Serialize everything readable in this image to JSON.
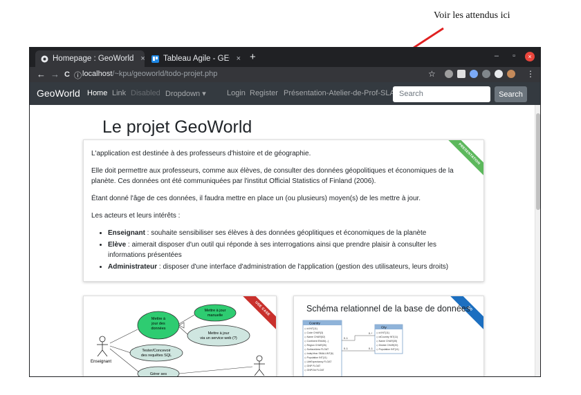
{
  "annotation": {
    "text": "Voir les attendus ici"
  },
  "browser": {
    "tabs": [
      {
        "label": "Homepage : GeoWorld",
        "close": "×"
      },
      {
        "label": "Tableau Agile - GEOWORL",
        "close": "×"
      }
    ],
    "new_tab": "+",
    "window_controls": {
      "minimize": "–",
      "maximize": "▫",
      "close": "×"
    },
    "nav": {
      "back": "←",
      "forward": "→",
      "reload": "C",
      "info": "ⓘ"
    },
    "url_host": "localhost",
    "url_path": "/~kpu/geoworld/todo-projet.php",
    "star": "☆",
    "menu": "⋮"
  },
  "navbar": {
    "brand": "GeoWorld",
    "links": [
      {
        "label": "Home",
        "state": "active"
      },
      {
        "label": "Link",
        "state": "normal"
      },
      {
        "label": "Disabled",
        "state": "disabled"
      },
      {
        "label": "Dropdown ▾",
        "state": "normal"
      }
    ],
    "right_links": [
      "Login",
      "Register",
      "Présentation-Atelier-de-Prof-SLAM"
    ],
    "search_placeholder": "Search",
    "search_button": "Search"
  },
  "page": {
    "title": "Le projet GeoWorld",
    "intro": {
      "ribbon": "PRESENTATION",
      "p1": "L'application est destinée à des professeurs d'histoire et de géographie.",
      "p2": "Elle doit permettre aux professeurs, comme aux élèves, de consulter des données géopolitiques et économiques de la planète. Ces données ont été communiquées par l'institut Official Statistics of Finland (2006).",
      "p3": "Étant donné l'âge de ces données, il faudra mettre en place un (ou plusieurs) moyen(s) de les mettre à jour.",
      "p4": "Les acteurs et leurs intérêts :",
      "actors": [
        {
          "name": "Enseignant",
          "text": " : souhaite sensibiliser ses élèves à des données géoplitiques et économiques de la planète"
        },
        {
          "name": "Elève",
          "text": " : aimerait disposer d'un outil qui réponde à ses interrogations ainsi que prendre plaisir à consulter les informations présentées"
        },
        {
          "name": "Administrateur",
          "text": " : disposer d'une interface d'administration de l'application (gestion des utilisateurs, leurs droits)"
        }
      ]
    },
    "usecase": {
      "ribbon": "USE CASE",
      "nodes": [
        "Mettre à",
        "jour des",
        "données",
        "Mettre à jour",
        "manuelle",
        "Mettre à jour",
        "via un service web (?)",
        "Tester/Concevoir",
        "des requêtes SQL",
        "Gérer ses"
      ],
      "actor": "Enseignant"
    },
    "schema": {
      "ribbon": "BD",
      "title": "Schéma relationnel de la base de données",
      "country_table": "Country",
      "country_fields": [
        "id INT(11)",
        "Code CHAR(3)",
        "Name CHAR(52)",
        "Continent ENUM(...)",
        "Region CHAR(26)",
        "SurfaceArea FLOAT",
        "IndepYear SMALLINT(6)",
        "Population INT(11)",
        "LifeExpectancy FLOAT",
        "GNP FLOAT",
        "GNPOld FLOAT"
      ],
      "city_table": "City",
      "city_fields": [
        "id INT(11)",
        "idCountry INT(11)",
        "Name CHAR(35)",
        "District CHAR(20)",
        "Population INT(11)"
      ],
      "cardinalities": [
        "0..1",
        "0..*",
        "0..1",
        "0..1"
      ]
    }
  },
  "colors": {
    "navbar": "#343a40",
    "chrome": "#202124",
    "ribbon_green": "#5cb85c",
    "ribbon_red": "#c9302c",
    "ribbon_blue": "#1c6fc0",
    "node_green": "#2ecc71",
    "node_blue": "#cfe6e0"
  }
}
